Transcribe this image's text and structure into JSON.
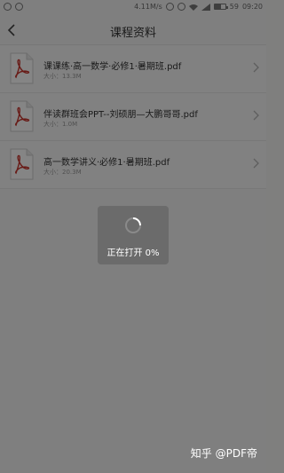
{
  "status_bar": {
    "speed": "4.11M/s",
    "battery": "59",
    "battery_level": 0.59,
    "time": "09:20"
  },
  "nav": {
    "title": "课程资料"
  },
  "files": [
    {
      "name": "课课练·高一数学·必修1·暑期班.pdf",
      "size": "大小：13.3M"
    },
    {
      "name": "伴读群班会PPT--刘硕朋—大鹏哥哥.pdf",
      "size": "大小：1.0M"
    },
    {
      "name": "高一数学讲义·必修1·暑期班.pdf",
      "size": "大小：20.3M"
    }
  ],
  "loading": {
    "text": "正在打开 0%"
  },
  "watermark": "知乎 @PDF帝",
  "icons": [
    "alarm-icon",
    "record-icon",
    "wifi-icon",
    "signal-icon",
    "battery-icon",
    "back-arrow-icon",
    "pdf-file-icon",
    "chevron-right-icon",
    "spinner-icon"
  ],
  "colors": {
    "pdf_red": "#c8352c",
    "overlay": "#000000"
  }
}
